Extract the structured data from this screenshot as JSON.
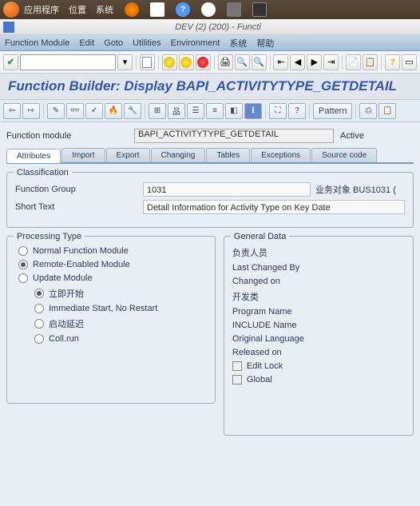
{
  "os_menu": {
    "apps": "应用程序",
    "places": "位置",
    "system": "系统"
  },
  "window_title": "DEV (2) (200) - Functi",
  "sap_menu": {
    "fm": "Function Module",
    "edit": "Edit",
    "goto": "Goto",
    "utilities": "Utilities",
    "environment": "Environment",
    "system": "系统",
    "help": "帮助"
  },
  "toolbar_field": "",
  "page_title": "Function Builder: Display BAPI_ACTIVITYTYPE_GETDETAIL",
  "tb2": {
    "pattern": "Pattern"
  },
  "fm_label": "Function module",
  "fm_value": "BAPI_ACTIVITYTYPE_GETDETAIL",
  "fm_status": "Active",
  "tabs": {
    "attributes": "Attributes",
    "import": "Import",
    "export": "Export",
    "changing": "Changing",
    "tables": "Tables",
    "exceptions": "Exceptions",
    "source": "Source code"
  },
  "classification": {
    "title": "Classification",
    "fg_label": "Function Group",
    "fg_value": "1031",
    "fg_right": "业务对象 BUS1031 (",
    "st_label": "Short Text",
    "st_value": "Detail Information for Activity Type on Key Date"
  },
  "processing": {
    "title": "Processing Type",
    "normal": "Normal Function Module",
    "remote": "Remote-Enabled Module",
    "update": "Update Module",
    "start": "立即开始",
    "immediate": "Immediate Start, No Restart",
    "delayed": "启动延迟",
    "coll": "Coll.run"
  },
  "general": {
    "title": "General Data",
    "responsible": "负责人员",
    "changed_by": "Last Changed By",
    "changed_on": "Changed on",
    "dev_class": "开发类",
    "program": "Program Name",
    "include": "INCLUDE Name",
    "orig_lang": "Original Language",
    "released": "Released on",
    "edit_lock": "Edit Lock",
    "global": "Global"
  }
}
